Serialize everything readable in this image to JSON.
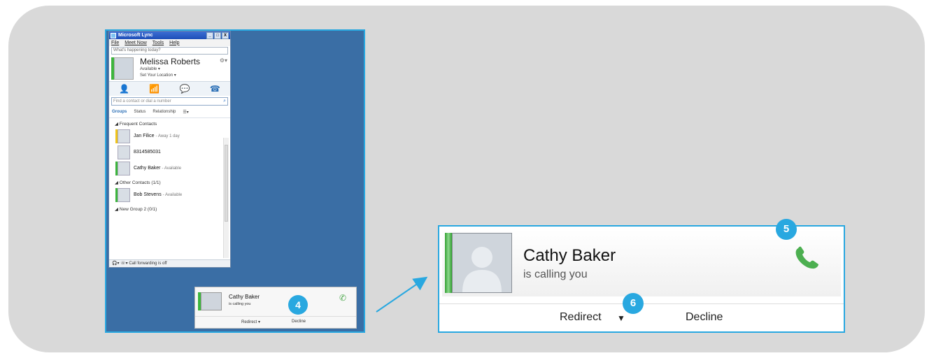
{
  "lync": {
    "title": "Microsoft Lync",
    "window_buttons": [
      "_",
      "□",
      "X"
    ],
    "menu": [
      "File",
      "Meet Now",
      "Tools",
      "Help"
    ],
    "status_placeholder": "What's happening today?",
    "user": {
      "name": "Melissa Roberts",
      "availability": "Available ▾",
      "location": "Set Your Location ▾"
    },
    "search_placeholder": "Find a contact or dial a number",
    "view_tabs": [
      "Groups",
      "Status",
      "Relationship"
    ],
    "groups": {
      "frequent": "◢ Frequent Contacts",
      "other": "◢ Other Contacts (1/1)",
      "new": "◢ New Group 2 (0/1)"
    },
    "contacts": [
      {
        "name": "Jan Filice",
        "status": "- Away 1 day"
      },
      {
        "name": "8314585031",
        "status": ""
      },
      {
        "name": "Cathy Baker",
        "status": "- Available"
      },
      {
        "name": "Bob Stevens",
        "status": "- Available"
      }
    ],
    "footer": "Call forwarding is off"
  },
  "toast": {
    "name": "Cathy Baker",
    "subtitle": "is calling you",
    "redirect": "Redirect ▾",
    "decline": "Decline"
  },
  "call_popup": {
    "name": "Cathy Baker",
    "subtitle": "is calling you",
    "redirect": "Redirect",
    "decline": "Decline"
  },
  "badges": {
    "b4": "4",
    "b5": "5",
    "b6": "6"
  },
  "colors": {
    "accent": "#29a8e0",
    "available": "#3db53d",
    "desktop": "#3a6ea5"
  }
}
